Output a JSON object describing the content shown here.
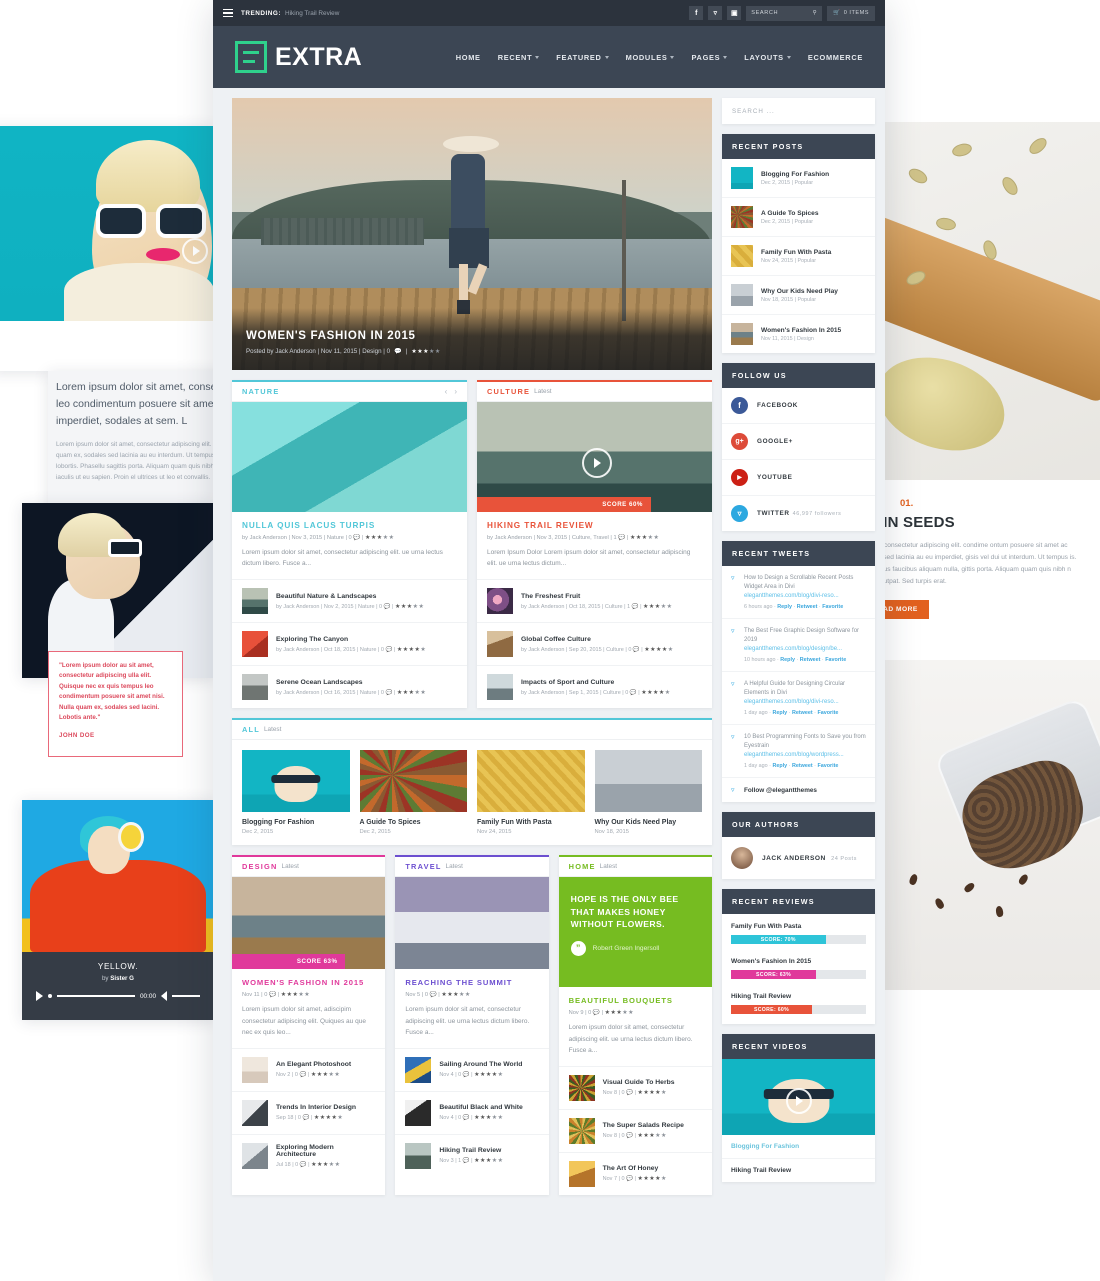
{
  "topbar": {
    "menu_icon": "hamburger-icon",
    "trending_label": "TRENDING:",
    "trending_text": "Hiking Trail Review",
    "social": [
      {
        "name": "facebook-icon",
        "glyph": "f"
      },
      {
        "name": "twitter-icon",
        "glyph": "ᵗ"
      },
      {
        "name": "instagram-icon",
        "glyph": "▣"
      }
    ],
    "search_label": "SEARCH",
    "search_icon": "magnifier-icon",
    "cart_icon": "cart-icon",
    "cart_label": "0 ITEMS"
  },
  "nav": {
    "logo_text": "EXTRA",
    "logo_color": "#2fd18c",
    "items": [
      {
        "label": "HOME",
        "has_caret": false
      },
      {
        "label": "RECENT",
        "has_caret": true
      },
      {
        "label": "FEATURED",
        "has_caret": true
      },
      {
        "label": "MODULES",
        "has_caret": true
      },
      {
        "label": "PAGES",
        "has_caret": true
      },
      {
        "label": "LAYOUTS",
        "has_caret": true
      },
      {
        "label": "ECOMMERCE",
        "has_caret": false
      }
    ]
  },
  "hero": {
    "title": "WOMEN'S FASHION IN 2015",
    "meta": "Posted by Jack Anderson | Nov 11, 2015 | Design | 0",
    "comment_icon": "comment-icon",
    "stars_on": 3,
    "stars_total": 5
  },
  "modules": {
    "nature": {
      "title": "NATURE",
      "sub": "",
      "accent": "#52c7d8",
      "prev_icon": "chevron-left-icon",
      "next_icon": "chevron-right-icon",
      "feature": {
        "title": "NULLA QUIS LACUS TURPIS",
        "meta": "by Jack Anderson | Nov 3, 2015 | Nature | 0",
        "stars_on": 3,
        "excerpt": "Lorem ipsum dolor sit amet, consectetur adipiscing elit. ue urna lectus dictum libero. Fusce a..."
      },
      "items": [
        {
          "title": "Beautiful Nature & Landscapes",
          "meta": "by Jack Anderson | Nov 2, 2015 | Nature | 0",
          "stars_on": 3,
          "thumb": "ph-mountain"
        },
        {
          "title": "Exploring The Canyon",
          "meta": "by Jack Anderson | Oct 18, 2015 | Nature | 0",
          "stars_on": 4,
          "thumb": "ph-canyon"
        },
        {
          "title": "Serene Ocean Landscapes",
          "meta": "by Jack Anderson | Oct 16, 2015 | Nature | 0",
          "stars_on": 3,
          "thumb": "ph-rocks"
        }
      ]
    },
    "culture": {
      "title": "CULTURE",
      "sub": "Latest",
      "accent": "#e8533a",
      "play_icon": "play-icon",
      "score_label": "SCORE 60%",
      "score_value": 60,
      "feature": {
        "title": "HIKING TRAIL REVIEW",
        "meta": "by Jack Anderson | Nov 3, 2015 | Culture, Travel | 1",
        "stars_on": 3,
        "excerpt": "Lorem Ipsum Dolor Lorem ipsum dolor sit amet, consectetur adipiscing elit. ue urna lectus dictum..."
      },
      "items": [
        {
          "title": "The Freshest Fruit",
          "meta": "by Jack Anderson | Oct 18, 2015 | Culture | 1",
          "stars_on": 3,
          "thumb": "ph-fruit"
        },
        {
          "title": "Global Coffee Culture",
          "meta": "by Jack Anderson | Sep 20, 2015 | Culture | 0",
          "stars_on": 4,
          "thumb": "ph-coffee"
        },
        {
          "title": "Impacts of Sport and Culture",
          "meta": "by Jack Anderson | Sep 1, 2015 | Culture | 0",
          "stars_on": 4,
          "thumb": "ph-sport"
        }
      ]
    },
    "all": {
      "title": "ALL",
      "sub": "Latest",
      "accent": "#52c7d8",
      "cells": [
        {
          "title": "Blogging For Fashion",
          "date": "Dec 2, 2015",
          "thumb": "ph-teal-girl"
        },
        {
          "title": "A Guide To Spices",
          "date": "Dec 2, 2015",
          "thumb": "ph-spices"
        },
        {
          "title": "Family Fun With Pasta",
          "date": "Nov 24, 2015",
          "thumb": "ph-pasta"
        },
        {
          "title": "Why Our Kids Need Play",
          "date": "Nov 18, 2015",
          "thumb": "ph-kid"
        }
      ]
    },
    "design": {
      "title": "DESIGN",
      "sub": "Latest",
      "accent": "#e0399b",
      "score_label": "SCORE 63%",
      "score_value": 63,
      "feature": {
        "title": "WOMEN'S FASHION IN 2015",
        "meta": "Nov 11 | 0",
        "stars_on": 3,
        "excerpt": "Lorem ipsum dolor sit amet, adiscipim consectetur adipiscing elit. Quiques au que nec ex quis leo..."
      },
      "items": [
        {
          "title": "An Elegant Photoshoot",
          "meta": "Nov 2 | 0",
          "stars_on": 3,
          "thumb": "ph-photoshoot"
        },
        {
          "title": "Trends In Interior Design",
          "meta": "Sep 18 | 0",
          "stars_on": 4,
          "thumb": "ph-interior"
        },
        {
          "title": "Exploring Modern Architecture",
          "meta": "Jul 18 | 0",
          "stars_on": 3,
          "thumb": "ph-modern"
        }
      ]
    },
    "travel": {
      "title": "TRAVEL",
      "sub": "Latest",
      "accent": "#6c4fd0",
      "feature": {
        "title": "REACHING THE SUMMIT",
        "meta": "Nov 5 | 0",
        "stars_on": 3,
        "excerpt": "Lorem ipsum dolor sit amet, consectetur adipiscing elit. ue urna lectus dictum libero. Fusce a..."
      },
      "items": [
        {
          "title": "Sailing Around The World",
          "meta": "Nov 4 | 0",
          "stars_on": 4,
          "thumb": "ph-sail"
        },
        {
          "title": "Beautiful Black and White",
          "meta": "Nov 4 | 0",
          "stars_on": 3,
          "thumb": "ph-bw"
        },
        {
          "title": "Hiking Trail Review",
          "meta": "Nov 3 | 1",
          "stars_on": 3,
          "thumb": "ph-hiking"
        }
      ]
    },
    "home": {
      "title": "HOME",
      "sub": "Latest",
      "accent": "#76bc21",
      "quote": {
        "text": "HOPE IS THE ONLY BEE THAT MAKES HONEY WITHOUT FLOWERS.",
        "author": "Robert Green Ingersoll",
        "mark_icon": "quote-icon"
      },
      "feature": {
        "title": "BEAUTIFUL BOUQUETS",
        "meta": "Nov 9 | 0",
        "stars_on": 3,
        "excerpt": "Lorem ipsum dolor sit amet, consectetur adipiscing elit. ue urna lectus dictum libero. Fusce a..."
      },
      "items": [
        {
          "title": "Visual Guide To Herbs",
          "meta": "Nov 8 | 0",
          "stars_on": 4,
          "thumb": "ph-herbs"
        },
        {
          "title": "The Super Salads Recipe",
          "meta": "Nov 8 | 0",
          "stars_on": 3,
          "thumb": "ph-salad"
        },
        {
          "title": "The Art Of Honey",
          "meta": "Nov 7 | 0",
          "stars_on": 4,
          "thumb": "ph-honey"
        }
      ]
    }
  },
  "sidebar": {
    "search_placeholder": "SEARCH ...",
    "recent_posts": {
      "heading": "RECENT POSTS",
      "items": [
        {
          "title": "Blogging For Fashion",
          "meta": "Dec 2, 2015 | Popular",
          "thumb": "ph-teal-girl"
        },
        {
          "title": "A Guide To Spices",
          "meta": "Dec 2, 2015 | Popular",
          "thumb": "ph-spices"
        },
        {
          "title": "Family Fun With Pasta",
          "meta": "Nov 24, 2015 | Popular",
          "thumb": "ph-pasta"
        },
        {
          "title": "Why Our Kids Need Play",
          "meta": "Nov 18, 2015 | Popular",
          "thumb": "ph-kid"
        },
        {
          "title": "Women's Fashion In 2015",
          "meta": "Nov 11, 2015 | Design",
          "thumb": "ph-dock"
        }
      ]
    },
    "follow_us": {
      "heading": "FOLLOW US",
      "items": [
        {
          "name": "FACEBOOK",
          "count": "",
          "color": "#3b5998",
          "glyph": "f",
          "icon": "facebook-icon"
        },
        {
          "name": "GOOGLE+",
          "count": "",
          "color": "#dd4b39",
          "glyph": "g+",
          "icon": "googleplus-icon"
        },
        {
          "name": "YOUTUBE",
          "count": "",
          "color": "#cc2015",
          "glyph": "▶",
          "icon": "youtube-icon"
        },
        {
          "name": "TWITTER",
          "count": "46,997 followers",
          "color": "#2ca8e0",
          "glyph": "ᵗ",
          "icon": "twitter-icon"
        }
      ]
    },
    "recent_tweets": {
      "heading": "RECENT TWEETS",
      "items": [
        {
          "text": "How to Design a Scrollable Recent Posts Widget Area in Divi",
          "link": "elegantthemes.com/blog/divi-reso...",
          "time": "6 hours ago",
          "actions": [
            "Reply",
            "Retweet",
            "Favorite"
          ]
        },
        {
          "text": "The Best Free Graphic Design Software for 2019",
          "link": "elegantthemes.com/blog/design/be...",
          "time": "10 hours ago",
          "actions": [
            "Reply",
            "Retweet",
            "Favorite"
          ]
        },
        {
          "text": "A Helpful Guide for Designing Circular Elements in Divi",
          "link": "elegantthemes.com/blog/divi-reso...",
          "time": "1 day ago",
          "actions": [
            "Reply",
            "Retweet",
            "Favorite"
          ]
        },
        {
          "text": "10 Best Programming Fonts to Save you from Eyestrain",
          "link": "elegantthemes.com/blog/wordpress...",
          "time": "1 day ago",
          "actions": [
            "Reply",
            "Retweet",
            "Favorite"
          ]
        }
      ],
      "follow_label": "Follow @elegantthemes"
    },
    "our_authors": {
      "heading": "OUR AUTHORS",
      "name": "JACK ANDERSON",
      "posts": "24 Posts"
    },
    "recent_reviews": {
      "heading": "RECENT REVIEWS",
      "items": [
        {
          "title": "Family Fun With Pasta",
          "label": "SCORE: 70%",
          "value": 70,
          "color": "#2ec4d8"
        },
        {
          "title": "Women's Fashion In 2015",
          "label": "SCORE: 63%",
          "value": 63,
          "color": "#e0399b"
        },
        {
          "title": "Hiking Trail Review",
          "label": "SCORE: 60%",
          "value": 60,
          "color": "#e8533a"
        }
      ]
    },
    "recent_videos": {
      "heading": "RECENT VIDEOS",
      "play_icon": "play-icon",
      "items": [
        {
          "title": "Blogging For Fashion",
          "active": true
        },
        {
          "title": "Hiking Trail Review",
          "active": false
        }
      ]
    }
  },
  "background": {
    "left_article": {
      "lead": "Lorem ipsum dolor sit amet, consectetu quis leo condimentum posuere sit amet sed lacinia imperdiet, sodales at sem. L",
      "body": "Lorem ipsum dolor sit amet, consectetur adipiscing elit. sit amet ac nisi. Nulla quam ex, sodales sed lacinia au eu interdum. Ut tempus ex vel sollicitudin lobortis. Phasellu sagittis porta. Aliquam quam quis nibh ante. Aliquam eu iaculis ut eu sapien. Proin el ultrices ut leo et convallis."
    },
    "quote_card": {
      "text": "\"Lorem ipsum dolor au sit amet, consectetur adipiscing ulla elit. Quisque nec ex quis tempus leo condimentum posuere sit amet nisi. Nulla quam ex, sodales sed lacini. Lobotis ante.\"",
      "author": "JOHN DOE"
    },
    "audio_player": {
      "track": "YELLOW.",
      "by_label": "by",
      "artist": "Sister G",
      "time": "00:00",
      "play_icon": "play-icon",
      "volume_icon": "volume-icon"
    },
    "right_article": {
      "number": "01.",
      "heading": "PKIN SEEDS",
      "body": "t amet, consectetur adipiscing elit. condime ontum posuere sit amet ac odales sed lacinia au eu imperdiet, gisis vel dui ut interdum. Ut tempus is. Phasellus faucibus aliquam nulla, gittis porta. Aliquam quam quis nibh n erat volutpat. Sed turpis erat.",
      "read_more": "READ MORE"
    }
  }
}
